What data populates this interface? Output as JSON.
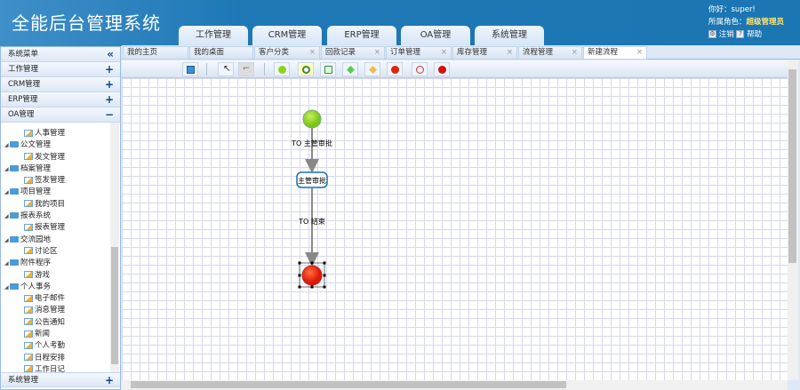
{
  "header": {
    "title": "全能后台管理系统",
    "greeting": "你好：super!",
    "role_label": "所属角色：",
    "role": "超级管理员",
    "logout": "注销",
    "help": "帮助"
  },
  "main_tabs": [
    "工作管理",
    "CRM管理",
    "ERP管理",
    "OA管理",
    "系统管理"
  ],
  "sidebar": {
    "title": "系统菜单",
    "collapse": "«",
    "sections": [
      {
        "label": "工作管理",
        "sign": "+"
      },
      {
        "label": "CRM管理",
        "sign": "+"
      },
      {
        "label": "ERP管理",
        "sign": "+"
      },
      {
        "label": "OA管理",
        "sign": "−"
      }
    ],
    "bottom": {
      "label": "系统管理",
      "sign": "+"
    },
    "tree": [
      {
        "type": "l",
        "label": "人事管理"
      },
      {
        "type": "f",
        "label": "公文管理"
      },
      {
        "type": "l",
        "label": "发文管理"
      },
      {
        "type": "f",
        "label": "档案管理"
      },
      {
        "type": "l",
        "label": "签发管理"
      },
      {
        "type": "f",
        "label": "项目管理"
      },
      {
        "type": "l",
        "label": "我的项目"
      },
      {
        "type": "f",
        "label": "报表系统"
      },
      {
        "type": "l",
        "label": "报表管理"
      },
      {
        "type": "f",
        "label": "交流园地"
      },
      {
        "type": "l",
        "label": "讨论区"
      },
      {
        "type": "f",
        "label": "附件程序"
      },
      {
        "type": "l",
        "label": "游戏"
      },
      {
        "type": "f",
        "label": "个人事务"
      },
      {
        "type": "l",
        "label": "电子邮件"
      },
      {
        "type": "l",
        "label": "消息管理"
      },
      {
        "type": "l",
        "label": "公告通知"
      },
      {
        "type": "l",
        "label": "新闻"
      },
      {
        "type": "l",
        "label": "个人考勤"
      },
      {
        "type": "l",
        "label": "日程安排"
      },
      {
        "type": "l",
        "label": "工作日记"
      }
    ]
  },
  "tabs": [
    {
      "label": "我的主页",
      "close": false
    },
    {
      "label": "我的桌面",
      "close": false
    },
    {
      "label": "客户分类",
      "close": true
    },
    {
      "label": "回款记录",
      "close": true
    },
    {
      "label": "订单管理",
      "close": true
    },
    {
      "label": "库存管理",
      "close": true
    },
    {
      "label": "流程管理",
      "close": true
    },
    {
      "label": "新建流程",
      "close": true,
      "active": true
    }
  ],
  "flow": {
    "start_label": "TO 主管审批",
    "task": "主管审批",
    "end_label": "TO 结束"
  }
}
